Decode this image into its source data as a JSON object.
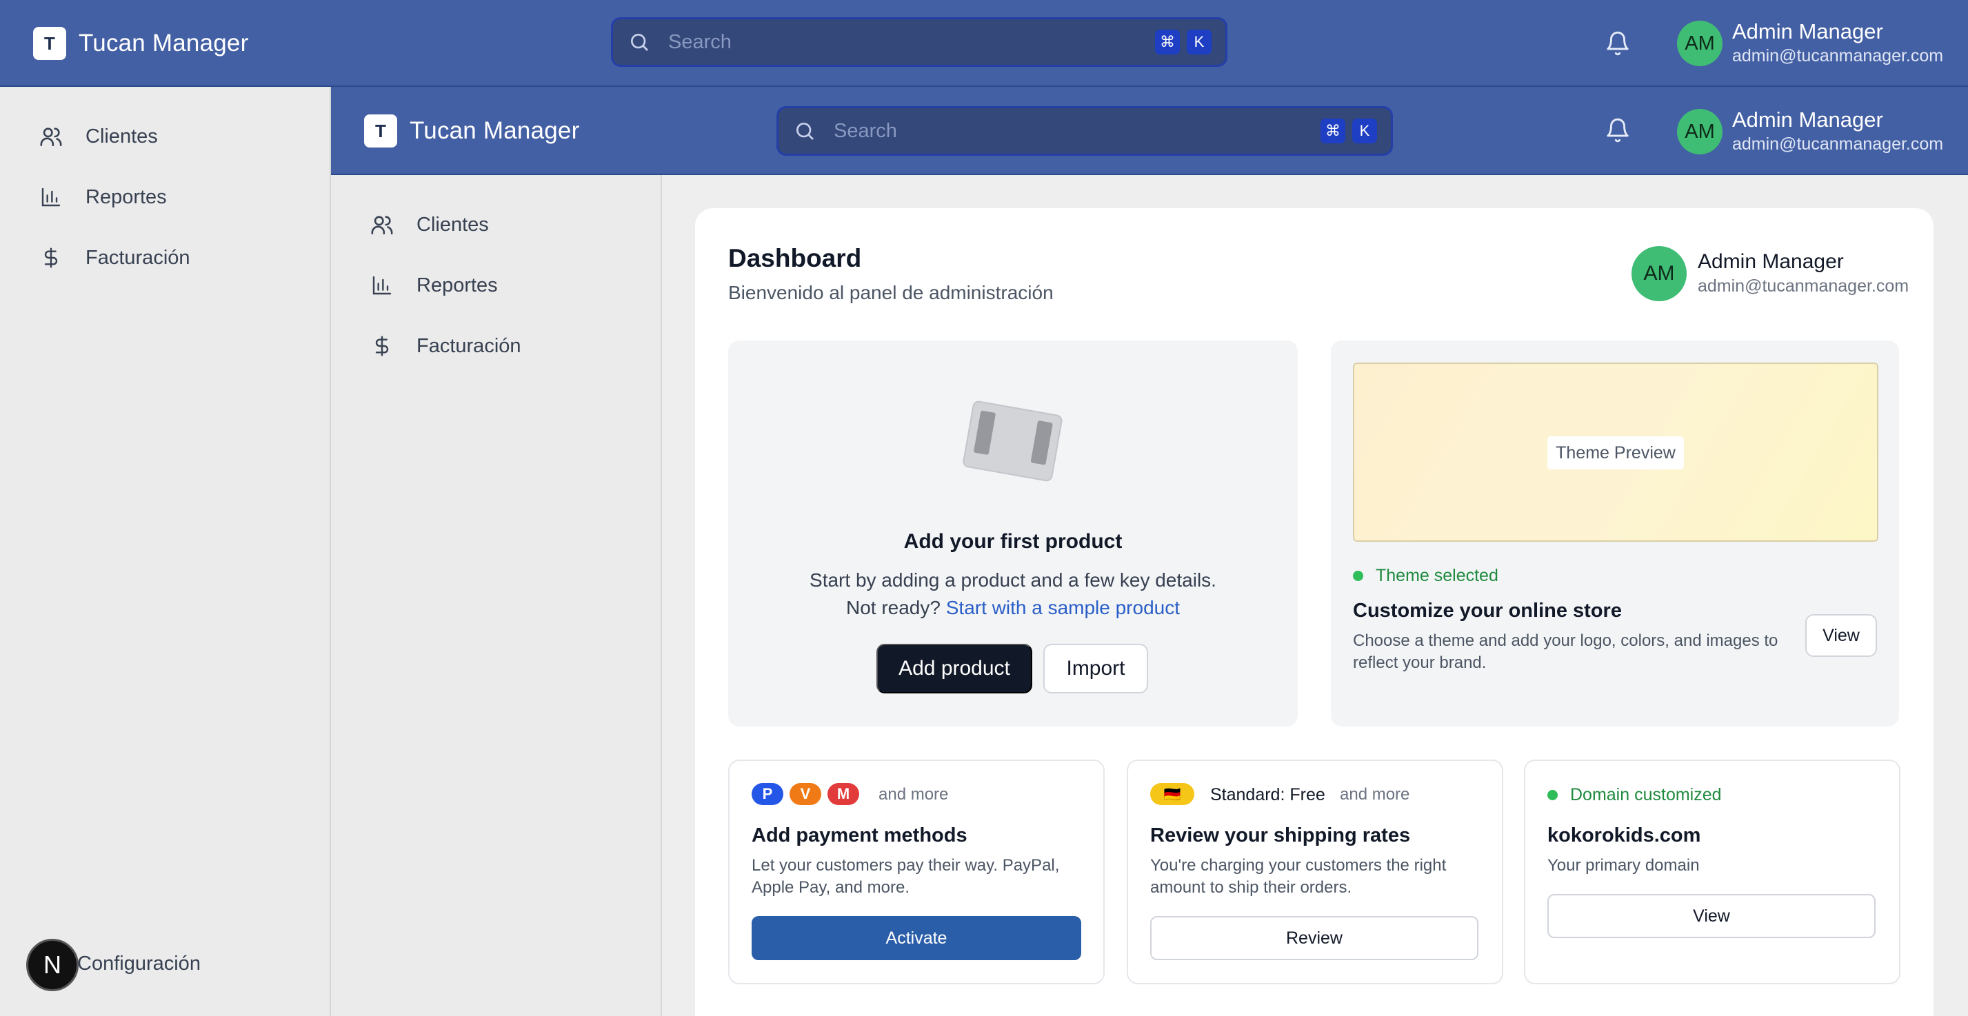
{
  "app": {
    "logo_letter": "T",
    "name": "Tucan Manager"
  },
  "search": {
    "placeholder": "Search",
    "kbd_cmd": "⌘",
    "kbd_key": "K"
  },
  "user": {
    "initials": "AM",
    "name": "Admin Manager",
    "email": "admin@tucanmanager.com"
  },
  "sidebar": {
    "items": [
      {
        "label": "Clientes",
        "icon": "users-icon"
      },
      {
        "label": "Reportes",
        "icon": "bar-chart-icon"
      },
      {
        "label": "Facturación",
        "icon": "dollar-icon"
      }
    ],
    "footer_label": "Configuración",
    "fab_letter": "N"
  },
  "dashboard": {
    "title": "Dashboard",
    "subtitle": "Bienvenido al panel de administración",
    "product": {
      "title": "Add your first product",
      "desc": "Start by adding a product and a few key details.",
      "not_ready": "Not ready?",
      "sample_link": "Start with a sample product",
      "add_button": "Add product",
      "import_button": "Import"
    },
    "theme": {
      "preview_label": "Theme Preview",
      "status": "Theme selected",
      "title": "Customize your online store",
      "desc": "Choose a theme and add your logo, colors, and images to reflect your brand.",
      "view_button": "View"
    },
    "payment": {
      "badges": [
        {
          "letter": "P",
          "color": "#2456e8"
        },
        {
          "letter": "V",
          "color": "#f07a16"
        },
        {
          "letter": "M",
          "color": "#e23b3b"
        }
      ],
      "more": "and more",
      "title": "Add payment methods",
      "desc": "Let your customers pay their way. PayPal, Apple Pay, and more.",
      "button": "Activate"
    },
    "shipping": {
      "flag": "🇩🇪",
      "standard": "Standard: Free",
      "more": "and more",
      "title": "Review your shipping rates",
      "desc": "You're charging your customers the right amount to ship their orders.",
      "button": "Review"
    },
    "domain": {
      "status": "Domain customized",
      "title": "kokorokids.com",
      "desc": "Your primary domain",
      "button": "View"
    }
  },
  "colors": {
    "header": "#4460a4",
    "accent_blue": "#2a5ea8",
    "success": "#2ebd59",
    "link": "#2a5ec8"
  }
}
